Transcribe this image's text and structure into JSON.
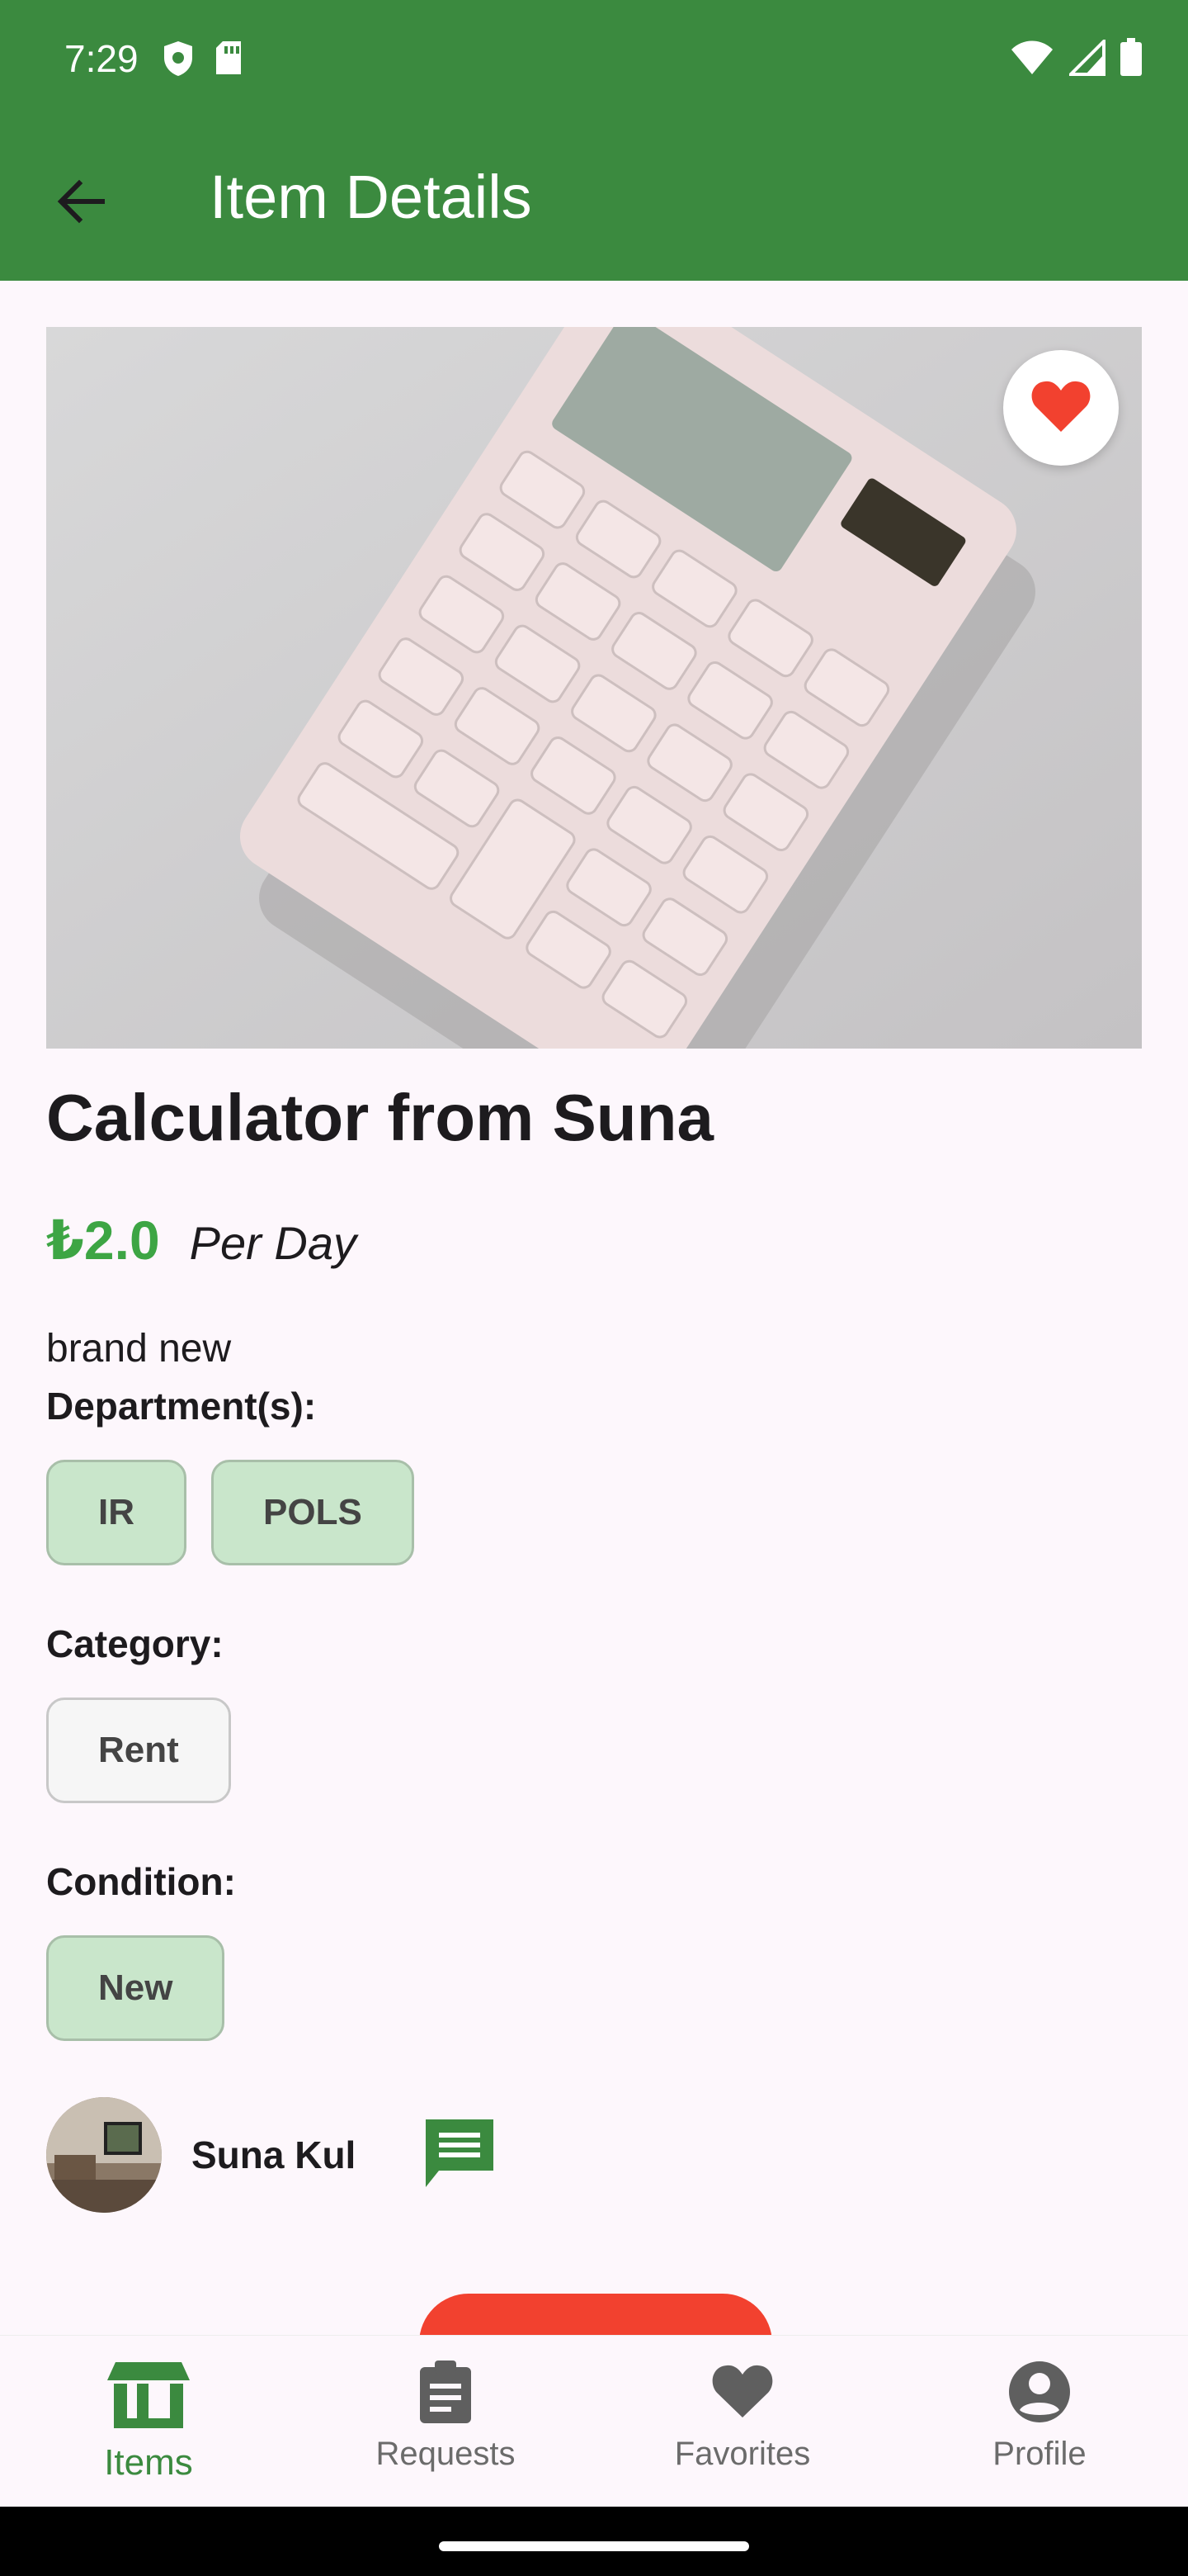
{
  "status_bar": {
    "time": "7:29"
  },
  "app_bar": {
    "title": "Item Details"
  },
  "item": {
    "title": "Calculator from Suna",
    "price": "₺2.0",
    "price_unit": "Per Day",
    "description": "brand new",
    "departments_label": "Department(s):",
    "departments": [
      "IR",
      "POLS"
    ],
    "category_label": "Category:",
    "category": "Rent",
    "condition_label": "Condition:",
    "condition": "New"
  },
  "owner": {
    "name": "Suna Kul"
  },
  "bottom_nav": {
    "items": [
      {
        "label": "Items",
        "icon": "storefront-icon",
        "active": true
      },
      {
        "label": "Requests",
        "icon": "clipboard-icon",
        "active": false
      },
      {
        "label": "Favorites",
        "icon": "heart-icon",
        "active": false
      },
      {
        "label": "Profile",
        "icon": "account-circle-icon",
        "active": false
      }
    ]
  },
  "colors": {
    "primary": "#3b8a3f",
    "price": "#3da544",
    "favorite": "#f2412f",
    "chip_green": "#c9e6cb"
  }
}
